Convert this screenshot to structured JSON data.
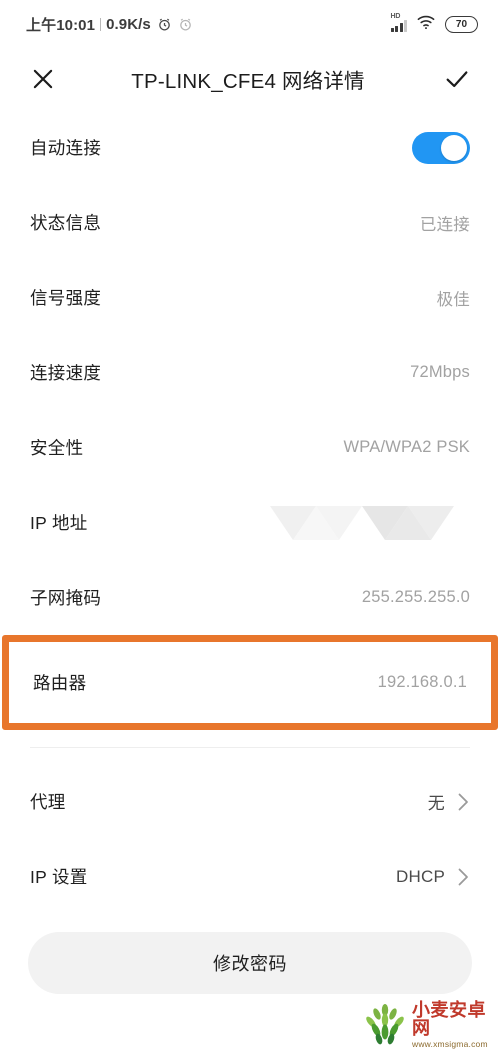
{
  "statusbar": {
    "time": "上午10:01",
    "network_speed": "0.9K/s",
    "alarm_icon": "alarm-clock-icon",
    "alarm_icon_2": "alarm-clock-outline-icon",
    "hd_label": "HD",
    "signal_icon": "signal-bars-icon",
    "wifi_icon": "wifi-icon",
    "battery_level": "70"
  },
  "appbar": {
    "close_icon": "close-icon",
    "title": "TP-LINK_CFE4 网络详情",
    "confirm_icon": "check-icon"
  },
  "rows": [
    {
      "label": "自动连接",
      "type": "toggle",
      "toggle_on": true
    },
    {
      "label": "状态信息",
      "value": "已连接",
      "type": "value"
    },
    {
      "label": "信号强度",
      "value": "极佳",
      "type": "value"
    },
    {
      "label": "连接速度",
      "value": "72Mbps",
      "type": "value"
    },
    {
      "label": "安全性",
      "value": "WPA/WPA2 PSK",
      "type": "value"
    },
    {
      "label": "IP 地址",
      "value": "",
      "type": "masked"
    },
    {
      "label": "子网掩码",
      "value": "255.255.255.0",
      "type": "value"
    },
    {
      "label": "路由器",
      "value": "192.168.0.1",
      "type": "value",
      "highlighted": true
    }
  ],
  "settings_rows": [
    {
      "label": "代理",
      "value": "无",
      "chevron": "chevron-right-icon"
    },
    {
      "label": "IP 设置",
      "value": "DHCP",
      "chevron": "chevron-right-icon"
    }
  ],
  "footer": {
    "change_password_label": "修改密码"
  },
  "watermark": {
    "logo_icon": "wheat-logo-icon",
    "site_name": "小麦安卓网",
    "site_url": "www.xmsigma.com"
  },
  "colors": {
    "accent_blue": "#2196f3",
    "highlight_orange": "#e8762c",
    "value_gray": "#a2a2a2",
    "watermark_red": "#c0392b"
  }
}
